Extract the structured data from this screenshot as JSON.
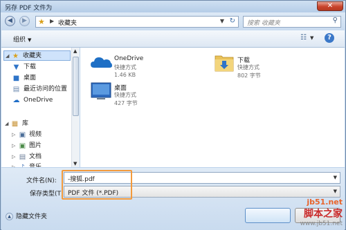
{
  "window": {
    "title": "另存 PDF 文件为",
    "close_glyph": "✕"
  },
  "address": {
    "back_glyph": "◀",
    "forward_glyph": "▶",
    "star_glyph": "★",
    "separator": "▶",
    "crumb": "收藏夹",
    "dropdown_glyph": "▼",
    "refresh_glyph": "↻",
    "search_placeholder": "搜索 收藏夹",
    "search_glyph": "⚲"
  },
  "toolbar": {
    "organize_label": "组织",
    "caret": "▼",
    "help_glyph": "?"
  },
  "nav": {
    "scroll_up": "▲",
    "scroll_down": "▼",
    "items": [
      {
        "label": "收藏夹",
        "expander": "◢",
        "icon": "star-icon",
        "glyph": "★",
        "color": "#d9a01b"
      },
      {
        "label": "下载",
        "icon": "download-folder-icon",
        "glyph": "▼",
        "color": "#2f74c8"
      },
      {
        "label": "桌面",
        "icon": "desktop-icon",
        "glyph": "■",
        "color": "#2f74c8"
      },
      {
        "label": "最近访问的位置",
        "icon": "recent-places-icon",
        "glyph": "▤",
        "color": "#6c8ab0"
      },
      {
        "label": "OneDrive",
        "icon": "onedrive-icon",
        "glyph": "☁",
        "color": "#1f6ec7"
      },
      {
        "label": "库",
        "expander": "◢",
        "icon": "libraries-icon",
        "glyph": "▦",
        "color": "#c9953a"
      },
      {
        "label": "视频",
        "expander": "▷",
        "icon": "video-library-icon",
        "glyph": "▣",
        "color": "#4d6f99"
      },
      {
        "label": "图片",
        "expander": "▷",
        "icon": "pictures-library-icon",
        "glyph": "▣",
        "color": "#4d8c4a"
      },
      {
        "label": "文档",
        "expander": "▷",
        "icon": "documents-library-icon",
        "glyph": "▤",
        "color": "#6c7f99"
      },
      {
        "label": "音乐",
        "expander": "▷",
        "icon": "music-library-icon",
        "glyph": "♪",
        "color": "#3b6fb3"
      }
    ]
  },
  "content": {
    "tiles": [
      {
        "name": "OneDrive",
        "type": "快捷方式",
        "size": "1.46 KB",
        "icon": "onedrive-cloud-icon"
      },
      {
        "name": "下载",
        "type": "快捷方式",
        "size": "802 字节",
        "icon": "downloads-folder-icon"
      },
      {
        "name": "桌面",
        "type": "快捷方式",
        "size": "427 字节",
        "icon": "desktop-shortcut-icon"
      }
    ]
  },
  "form": {
    "filename_label": "文件名(N):",
    "filename_value": "-搜狐.pdf",
    "filetype_label": "保存类型(T):",
    "filetype_value": "PDF 文件 (*.PDF)",
    "dropdown_glyph": "▼",
    "hide_folders_label": "隐藏文件夹",
    "hide_glyph": "▲"
  },
  "watermark": {
    "line1": "jb51.net",
    "line2": "脚本之家",
    "line3": "www.jb51.net"
  },
  "colors": {
    "accent": "#3b78c8",
    "highlight": "#f39a3c"
  }
}
